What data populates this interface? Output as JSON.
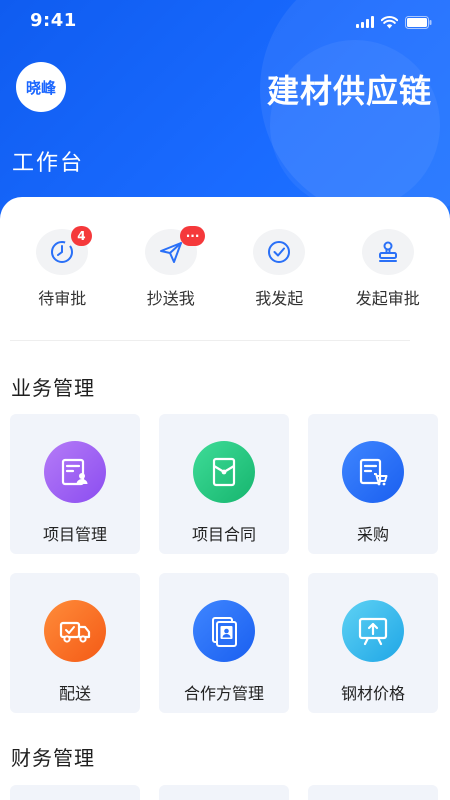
{
  "status_bar": {
    "time": "9:41"
  },
  "header": {
    "avatar_text": "晓峰",
    "app_title": "建材供应链",
    "workbench_title": "工作台"
  },
  "quick_actions": [
    {
      "label": "待审批",
      "icon": "clock-check-icon",
      "badge": "4"
    },
    {
      "label": "抄送我",
      "icon": "paper-plane-icon",
      "badge": "···"
    },
    {
      "label": "我发起",
      "icon": "check-circle-icon"
    },
    {
      "label": "发起审批",
      "icon": "stamp-icon"
    }
  ],
  "sections": {
    "business": {
      "title": "业务管理",
      "items": [
        {
          "label": "项目管理",
          "icon": "project-document-icon",
          "color": "#9b5cf4"
        },
        {
          "label": "项目合同",
          "icon": "contract-envelope-icon",
          "color": "#1fc47d"
        },
        {
          "label": "采购",
          "icon": "purchase-cart-icon",
          "color": "#2a70f7"
        },
        {
          "label": "配送",
          "icon": "delivery-truck-icon",
          "color": "#f86a22"
        },
        {
          "label": "合作方管理",
          "icon": "partner-card-icon",
          "color": "#2a70f7"
        },
        {
          "label": "钢材价格",
          "icon": "price-board-icon",
          "color": "#2fb9ee"
        }
      ]
    },
    "finance": {
      "title": "财务管理"
    }
  },
  "colors": {
    "header_blue": "#1a66ff",
    "badge_red": "#f5393b",
    "card_bg": "#f1f4fa"
  }
}
